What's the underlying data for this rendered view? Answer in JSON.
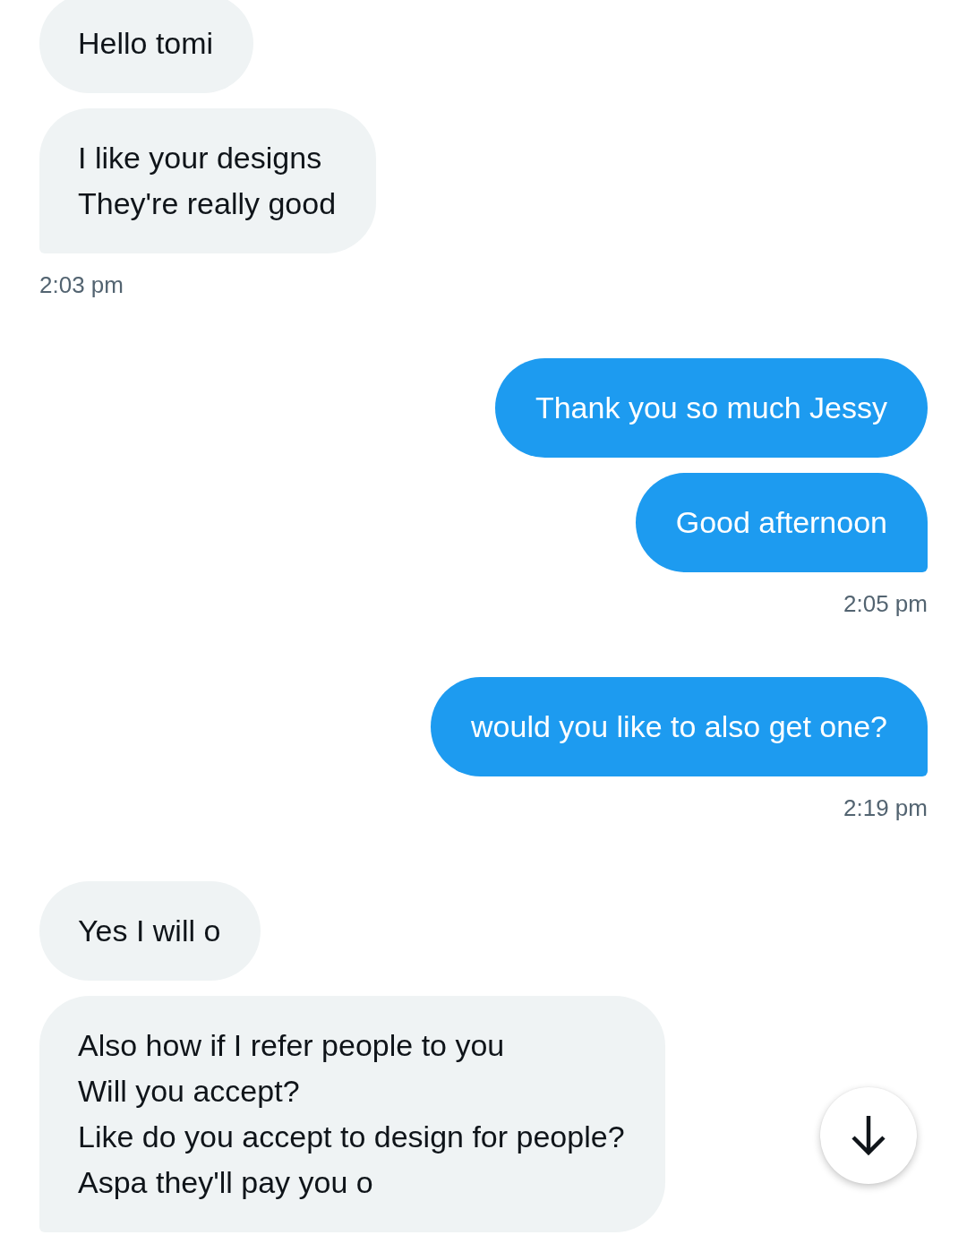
{
  "conversation": [
    {
      "kind": "received",
      "messages": [
        {
          "text": "Hello tomi"
        },
        {
          "text": "I like your designs\nThey're really good"
        }
      ],
      "time": "2:03 pm"
    },
    {
      "kind": "sent",
      "messages": [
        {
          "text": "Thank you so much Jessy"
        },
        {
          "text": "Good afternoon"
        }
      ],
      "time": "2:05 pm"
    },
    {
      "kind": "sent",
      "messages": [
        {
          "text": "would you like to also get one?"
        }
      ],
      "time": "2:19 pm"
    },
    {
      "kind": "received",
      "messages": [
        {
          "text": "Yes I will o"
        },
        {
          "text": "Also how if I refer people to you\nWill you accept?\nLike do you accept to design for people?\nAspa they'll pay you o"
        }
      ]
    }
  ]
}
